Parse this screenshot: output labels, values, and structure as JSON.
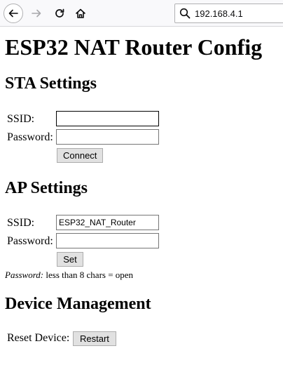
{
  "browser": {
    "url": "192.168.4.1",
    "icons": [
      "back-arrow-icon",
      "forward-arrow-icon",
      "reload-icon",
      "home-icon",
      "search-icon"
    ]
  },
  "page": {
    "title": "ESP32 NAT Router Config",
    "sta": {
      "heading": "STA Settings",
      "ssid_label": "SSID:",
      "ssid_value": "",
      "password_label": "Password:",
      "password_value": "",
      "connect_label": "Connect"
    },
    "ap": {
      "heading": "AP Settings",
      "ssid_label": "SSID:",
      "ssid_value": "ESP32_NAT_Router",
      "password_label": "Password:",
      "password_value": "",
      "set_label": "Set",
      "note_italic": "Password:",
      "note_text": " less than 8 chars = open"
    },
    "device": {
      "heading": "Device Management",
      "reset_label": "Reset Device:",
      "restart_label": "Restart"
    }
  }
}
